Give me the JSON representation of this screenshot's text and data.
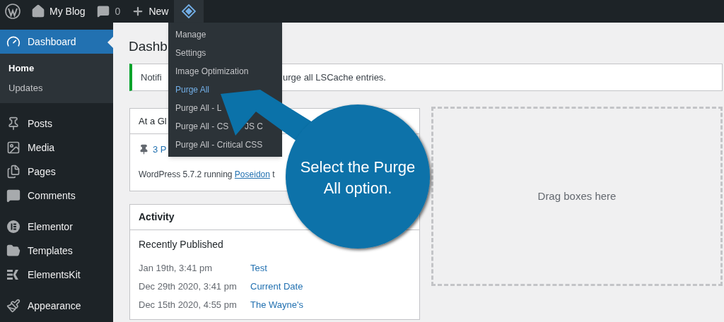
{
  "admin_bar": {
    "site": "My Blog",
    "comments": "0",
    "new": "New",
    "plugin_menu_open": true
  },
  "plugin_menu": [
    {
      "label": "Manage",
      "selected": false
    },
    {
      "label": "Settings",
      "selected": false
    },
    {
      "label": "Image Optimization",
      "selected": false
    },
    {
      "label": "Purge All",
      "selected": true
    },
    {
      "label": "Purge All - L",
      "selected": false
    },
    {
      "label": "Purge All - CS",
      "after": "JS C",
      "selected": false
    },
    {
      "label": "Purge All - Critical CSS",
      "selected": false
    }
  ],
  "sidebar": {
    "sections": [
      {
        "items": [
          {
            "label": "Dashboard",
            "selected": true,
            "children": [
              {
                "label": "Home",
                "selected": true
              },
              {
                "label": "Updates",
                "selected": false
              }
            ]
          }
        ]
      },
      {
        "items": [
          {
            "label": "Posts",
            "selected": false
          },
          {
            "label": "Media",
            "selected": false
          },
          {
            "label": "Pages",
            "selected": false
          },
          {
            "label": "Comments",
            "selected": false
          }
        ]
      },
      {
        "items": [
          {
            "label": "Elementor",
            "selected": false
          },
          {
            "label": "Templates",
            "selected": false
          },
          {
            "label": "ElementsKit",
            "selected": false
          }
        ]
      },
      {
        "items": [
          {
            "label": "Appearance",
            "selected": false
          }
        ]
      }
    ]
  },
  "page_title": "Dashb",
  "notice": {
    "before": "Notifi",
    "after": "urge all LSCache entries."
  },
  "at_a_glance": {
    "title": "At a Gl",
    "posts": "3 P",
    "version_text": "WordPress 5.7.2 running ",
    "theme_link": "Poseidon",
    "tail": "t"
  },
  "activity": {
    "title": "Activity",
    "subtitle": "Recently Published",
    "rows": [
      {
        "date": "Jan 19th, 3:41 pm",
        "title": "Test"
      },
      {
        "date": "Dec 29th 2020, 3:41 pm",
        "title": "Current Date"
      },
      {
        "date": "Dec 15th 2020, 4:55 pm",
        "title": "The Wayne's"
      }
    ]
  },
  "drop_zone": "Drag boxes here",
  "callout": "Select the Purge All option."
}
